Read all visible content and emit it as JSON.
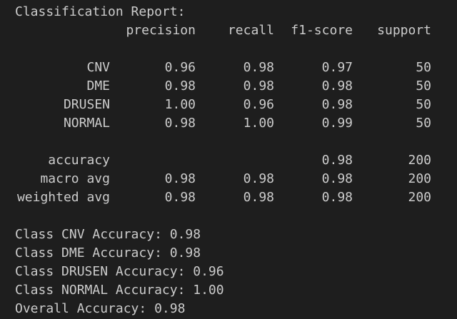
{
  "report": {
    "title": "Classification Report:",
    "headers": [
      "precision",
      "recall",
      "f1-score",
      "support"
    ],
    "rows": [
      {
        "label": "CNV",
        "precision": "0.96",
        "recall": "0.98",
        "f1": "0.97",
        "support": "50"
      },
      {
        "label": "DME",
        "precision": "0.98",
        "recall": "0.98",
        "f1": "0.98",
        "support": "50"
      },
      {
        "label": "DRUSEN",
        "precision": "1.00",
        "recall": "0.96",
        "f1": "0.98",
        "support": "50"
      },
      {
        "label": "NORMAL",
        "precision": "0.98",
        "recall": "1.00",
        "f1": "0.99",
        "support": "50"
      }
    ],
    "summary": [
      {
        "label": "accuracy",
        "precision": "",
        "recall": "",
        "f1": "0.98",
        "support": "200"
      },
      {
        "label": "macro avg",
        "precision": "0.98",
        "recall": "0.98",
        "f1": "0.98",
        "support": "200"
      },
      {
        "label": "weighted avg",
        "precision": "0.98",
        "recall": "0.98",
        "f1": "0.98",
        "support": "200"
      }
    ]
  },
  "class_accuracy": [
    "Class CNV Accuracy: 0.98",
    "Class DME Accuracy: 0.98",
    "Class DRUSEN Accuracy: 0.96",
    "Class NORMAL Accuracy: 1.00"
  ],
  "overall": "Overall Accuracy: 0.98",
  "colors": {
    "background": "#1e1e1e",
    "text": "#cccccc"
  }
}
